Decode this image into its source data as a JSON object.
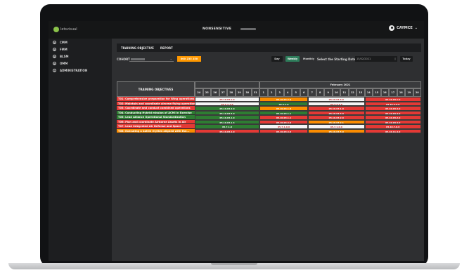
{
  "colors": {
    "red": "#e53935",
    "green": "#2e7d32",
    "orange": "#fb8c00",
    "white": "#f5f5f5",
    "accent": "#ff9800"
  },
  "header": {
    "logo_text": "letsvisual",
    "title": "NONSENSITIVE",
    "user": "CAYMCE",
    "user_caret": "⌄"
  },
  "sidebar": {
    "items": [
      {
        "icon": "circle-icon",
        "glyph": "⊕",
        "label": "CMM"
      },
      {
        "icon": "circle-icon",
        "glyph": "⊕",
        "label": "FMM"
      },
      {
        "icon": "circle-icon",
        "glyph": "⊕",
        "label": "BLSM"
      },
      {
        "icon": "circle-icon",
        "glyph": "⊕",
        "label": "OMM"
      },
      {
        "icon": "user-icon",
        "glyph": "♙",
        "label": "ADMINISTRATION"
      }
    ]
  },
  "tabs": [
    {
      "label": "TRAINING OBJECTIVE"
    },
    {
      "label": "REPORT"
    }
  ],
  "filters": {
    "cohort_label": "COHORT :",
    "cohort_caret": "⌄",
    "badge": "000 235 250",
    "day_label": "Day",
    "weekly_label": "Weekly",
    "monthly_label": "Monthly",
    "start_label": "Select the Starting Date",
    "start_date": "15/02/2021",
    "calendar_icon": "▯",
    "today_label": "Today"
  },
  "table": {
    "header_label": "TRAINING OBJECTIVES",
    "month_label": "February 2021",
    "days": [
      "24",
      "25",
      "26",
      "27",
      "28",
      "29",
      "30",
      "31",
      "1",
      "2",
      "3",
      "4",
      "5",
      "6",
      "7",
      "8",
      "9",
      "10",
      "11",
      "12",
      "13",
      "14",
      "15",
      "16",
      "17",
      "18",
      "19",
      "20"
    ],
    "rows": [
      {
        "objective": "T01: Comprehensive preparation for Wing operations",
        "color": "red",
        "segments": [
          {
            "start": 0,
            "span": 8,
            "color": "white",
            "text": "05.10.03.1.0"
          },
          {
            "start": 8,
            "span": 6,
            "color": "orange",
            "text": "05.10.03.2.0"
          },
          {
            "start": 14,
            "span": 7,
            "color": "white",
            "text": "05.10.03.3.0"
          },
          {
            "start": 21,
            "span": 7,
            "color": "red",
            "text": "05.10.03.1.0"
          }
        ]
      },
      {
        "objective": "T02: Maintain and coordinate aircrew flying operations",
        "color": "red",
        "segments": [
          {
            "start": 0,
            "span": 8,
            "color": "white",
            "text": "03.1.1.1.0"
          },
          {
            "start": 8,
            "span": 6,
            "color": "green",
            "text": "03.2.1.0"
          },
          {
            "start": 14,
            "span": 7,
            "color": "white",
            "text": "03.3.3.1.0"
          },
          {
            "start": 21,
            "span": 7,
            "color": "red",
            "text": "05.10.3.5.0"
          }
        ]
      },
      {
        "objective": "T03: Coordinate and conduct combined operations",
        "color": "red",
        "segments": [
          {
            "start": 0,
            "span": 8,
            "color": "green",
            "text": "05.10.03.2.0"
          },
          {
            "start": 8,
            "span": 6,
            "color": "orange",
            "text": "05.10.03.1.0"
          },
          {
            "start": 14,
            "span": 7,
            "color": "red",
            "text": "05.10.03.1.0"
          },
          {
            "start": 21,
            "span": 7,
            "color": "red",
            "text": "05.10.03.4.0"
          }
        ]
      },
      {
        "objective": "T04: Conducting Hybrid mission of ACMI in Exercise",
        "color": "green",
        "segments": [
          {
            "start": 0,
            "span": 8,
            "color": "green",
            "text": "05.10.03.5.0"
          },
          {
            "start": 8,
            "span": 6,
            "color": "green",
            "text": "05.10.03.1.1"
          },
          {
            "start": 14,
            "span": 7,
            "color": "red",
            "text": "05.10.03.3.0"
          },
          {
            "start": 21,
            "span": 7,
            "color": "red",
            "text": "05.10.03.4.0"
          }
        ]
      },
      {
        "objective": "T05: Lead Alliance Operational Standardization",
        "color": "green",
        "segments": [
          {
            "start": 0,
            "span": 8,
            "color": "green",
            "text": "05.10.03.1.0"
          },
          {
            "start": 8,
            "span": 6,
            "color": "red",
            "text": "05.10.03.1.1"
          },
          {
            "start": 14,
            "span": 7,
            "color": "red",
            "text": "05.10.03.2.0"
          },
          {
            "start": 21,
            "span": 7,
            "color": "red",
            "text": "05.10.03.2.0"
          }
        ]
      },
      {
        "objective": "T06: Plan and coordinate Airborne Assets in Air",
        "color": "red",
        "segments": [
          {
            "start": 0,
            "span": 8,
            "color": "green",
            "text": "05.10.03.1.4"
          },
          {
            "start": 8,
            "span": 6,
            "color": "red",
            "text": "05.10.03.4.0"
          },
          {
            "start": 14,
            "span": 7,
            "color": "orange",
            "text": "05.10.03.2.1"
          },
          {
            "start": 21,
            "span": 7,
            "color": "red",
            "text": "05.10.03.4.0"
          }
        ]
      },
      {
        "objective": "T07: Lead Integrated Air Defense and Space",
        "color": "red",
        "segments": [
          {
            "start": 0,
            "span": 8,
            "color": "green",
            "text": "05.7.1.0"
          },
          {
            "start": 8,
            "span": 6,
            "color": "white",
            "text": "05.7.1.0.0"
          },
          {
            "start": 14,
            "span": 7,
            "color": "white",
            "text": "05.7.1.0.0"
          },
          {
            "start": 21,
            "span": 7,
            "color": "red",
            "text": "05.10.7.0.0"
          }
        ]
      },
      {
        "objective": "T08: Executing a battle rhythm aligned with the...",
        "color": "orange",
        "segments": [
          {
            "start": 0,
            "span": 8,
            "color": "red",
            "text": "05.10.03.1.0"
          },
          {
            "start": 8,
            "span": 6,
            "color": "red",
            "text": "05.10.03.4.0"
          },
          {
            "start": 14,
            "span": 7,
            "color": "orange",
            "text": "05.10.03.5.0"
          },
          {
            "start": 21,
            "span": 7,
            "color": "red",
            "text": "05.10.11.4.0"
          }
        ]
      }
    ]
  }
}
